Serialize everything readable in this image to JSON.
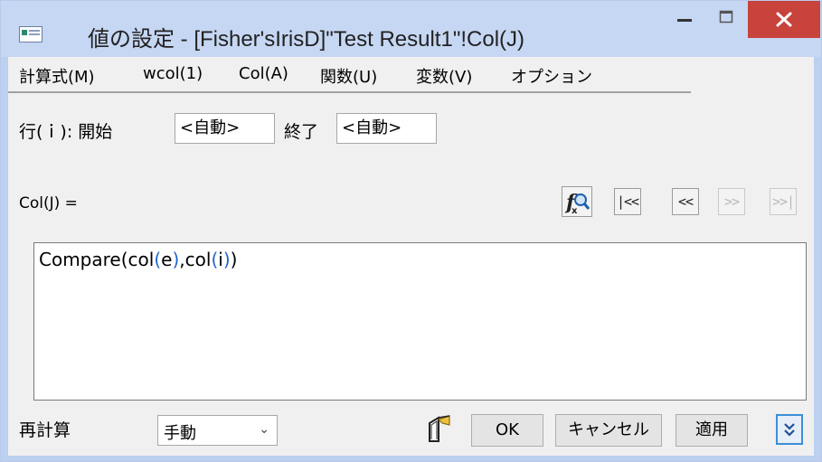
{
  "window": {
    "title": "値の設定 - [Fisher'sIrisD]\"Test Result1\"!Col(J)",
    "controls": [
      "minimize-icon",
      "maximize-icon",
      "close-icon"
    ],
    "close_color": "#c7433b",
    "titlebar_color": "#c6d7f3"
  },
  "menu": {
    "items": [
      {
        "label": "計算式(M)"
      },
      {
        "label": "wcol(1)"
      },
      {
        "label": "Col(A)"
      },
      {
        "label": "関数(U)"
      },
      {
        "label": "変数(V)"
      },
      {
        "label": "オプション"
      }
    ]
  },
  "rows": {
    "label": "行(ｉ): 開始",
    "start_value": "<自動>",
    "end_label": "終了",
    "end_value": "<自動>"
  },
  "formula": {
    "label": "Col(J) =",
    "nav": [
      {
        "label": "|<<",
        "enabled": true
      },
      {
        "label": "<<",
        "enabled": true
      },
      {
        "label": ">>",
        "enabled": false
      },
      {
        "label": ">>|",
        "enabled": false
      }
    ],
    "fx_icon": "function-search-icon",
    "code": {
      "fn": "Compare",
      "open": "(",
      "col1": "col",
      "arg1_open": "(",
      "arg1": "e",
      "arg1_close": ")",
      "sep": ",",
      "col2": "col",
      "arg2_open": "(",
      "arg2": "i",
      "arg2_close": ")",
      "close": ")"
    },
    "paren_color": "#1f66cc"
  },
  "footer": {
    "recalc_label": "再計算",
    "recalc_value": "手動",
    "ok": "OK",
    "cancel": "キャンセル",
    "apply": "適用",
    "tool_icon": "worksheet-tool-icon",
    "expand_icon": "double-chevron-down-icon"
  }
}
